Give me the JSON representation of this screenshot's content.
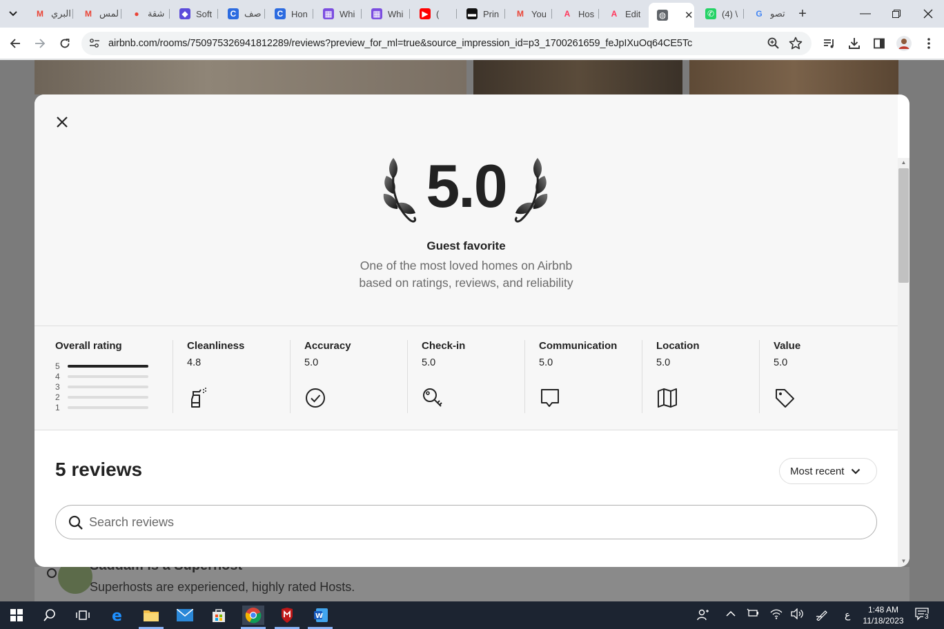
{
  "browser": {
    "tabs": [
      {
        "title": "البري",
        "icon": "gmail-icon",
        "color": "#ea4335",
        "glyph": "M"
      },
      {
        "title": "المس",
        "icon": "gmail-icon",
        "color": "#ea4335",
        "glyph": "M"
      },
      {
        "title": "شقة",
        "icon": "maps-pin-icon",
        "color": "#ea4335",
        "glyph": "●"
      },
      {
        "title": "Soft",
        "icon": "shield-icon",
        "color": "#5b4bdb",
        "glyph": "◆"
      },
      {
        "title": "صف",
        "icon": "copilot-c-icon",
        "color": "#2c6be0",
        "glyph": "C"
      },
      {
        "title": "Hon",
        "icon": "copilot-c-icon",
        "color": "#2c6be0",
        "glyph": "C"
      },
      {
        "title": "Whi",
        "icon": "clapper-icon",
        "color": "#7b4de0",
        "glyph": "▦"
      },
      {
        "title": "Whi",
        "icon": "clapper-icon",
        "color": "#7b4de0",
        "glyph": "▦"
      },
      {
        "title": "(",
        "icon": "youtube-icon",
        "color": "#ff0000",
        "glyph": "▶"
      },
      {
        "title": "Prin",
        "icon": "printful-icon",
        "color": "#111111",
        "glyph": "▬"
      },
      {
        "title": "You",
        "icon": "gmail-icon",
        "color": "#ea4335",
        "glyph": "M"
      },
      {
        "title": "Hos",
        "icon": "airbnb-icon",
        "color": "#ff385c",
        "glyph": "A"
      },
      {
        "title": "Edit",
        "icon": "airbnb-icon",
        "color": "#ff385c",
        "glyph": "A"
      },
      {
        "title": "",
        "icon": "globe-icon",
        "color": "#5f6368",
        "glyph": "◍",
        "active": true
      },
      {
        "title": "(4) \\",
        "icon": "whatsapp-icon",
        "color": "#25d366",
        "glyph": "✆"
      },
      {
        "title": "تصو",
        "icon": "google-icon",
        "color": "#4285f4",
        "glyph": "G"
      }
    ],
    "url": "airbnb.com/rooms/750975326941812289/reviews?preview_for_ml=true&source_impression_id=p3_1700261659_feJpIXuOq64CE5Tc"
  },
  "modal": {
    "rating": "5.0",
    "badge_title": "Guest favorite",
    "badge_desc_1": "One of the most loved homes on Airbnb",
    "badge_desc_2": "based on ratings, reviews, and reliability",
    "overall": {
      "label": "Overall rating",
      "rows": [
        {
          "n": "5",
          "fill": 1.0
        },
        {
          "n": "4",
          "fill": 0
        },
        {
          "n": "3",
          "fill": 0
        },
        {
          "n": "2",
          "fill": 0
        },
        {
          "n": "1",
          "fill": 0
        }
      ]
    },
    "categories": [
      {
        "label": "Cleanliness",
        "value": "4.8",
        "icon": "spray-bottle-icon"
      },
      {
        "label": "Accuracy",
        "value": "5.0",
        "icon": "check-circle-icon"
      },
      {
        "label": "Check-in",
        "value": "5.0",
        "icon": "key-icon"
      },
      {
        "label": "Communication",
        "value": "5.0",
        "icon": "chat-bubble-icon"
      },
      {
        "label": "Location",
        "value": "5.0",
        "icon": "map-icon"
      },
      {
        "label": "Value",
        "value": "5.0",
        "icon": "tag-icon"
      }
    ],
    "review_count": "5 reviews",
    "sort_label": "Most recent",
    "search_placeholder": "Search reviews"
  },
  "background": {
    "host_title": "Saddam is a Superhost",
    "host_sub": "Superhosts are experienced, highly rated Hosts."
  },
  "taskbar": {
    "time": "1:48 AM",
    "date": "11/18/2023",
    "lang": "ع",
    "notif_count": "3"
  }
}
